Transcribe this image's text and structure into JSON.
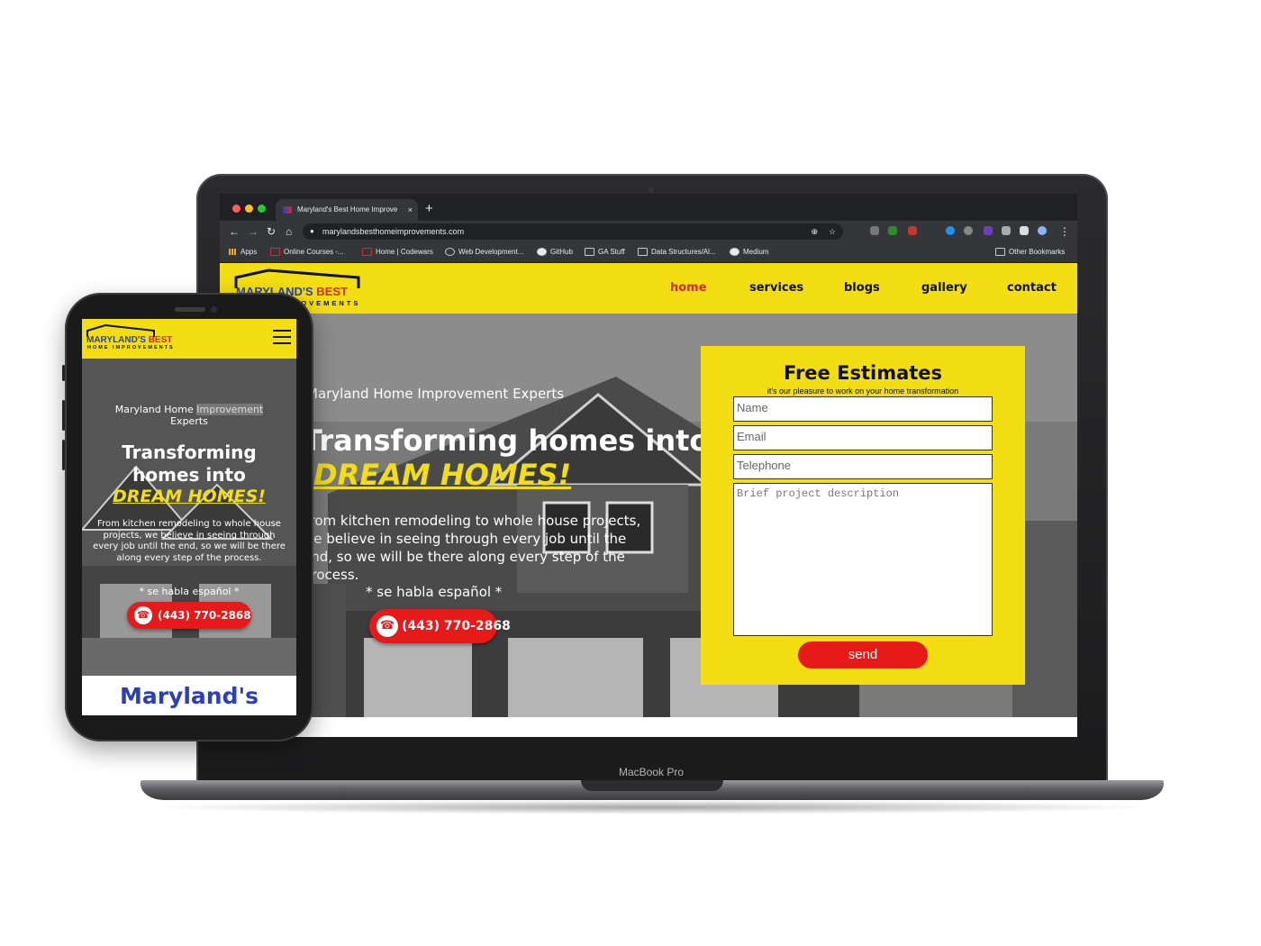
{
  "browser": {
    "tab_title": "Maryland's Best Home Improve",
    "tab_close": "×",
    "new_tab": "+",
    "url": "marylandsbesthomeimprovements.com",
    "bookmarks": [
      "Apps",
      "Online Courses -...",
      "Home | Codewars",
      "Web Development...",
      "GitHub",
      "GA Stuff",
      "Data Structures/Al...",
      "Medium"
    ],
    "other_bookmarks": "Other Bookmarks",
    "colors": {
      "frame": "#202124",
      "toolbar": "#35363a"
    }
  },
  "site": {
    "logo_main_a": "MARYLAND'S",
    "logo_main_b": "BEST",
    "logo_sub": "HOME IMPROVEMENTS",
    "nav": [
      "home",
      "services",
      "blogs",
      "gallery",
      "contact"
    ],
    "hero": {
      "kicker": "Maryland Home Improvement Experts",
      "title": "Transforming homes into",
      "dream": "DREAM HOMES!",
      "body": "From kitchen remodeling to whole house projects, we believe in seeing through every job until the end, so we will be there along every step of the process.",
      "spanish": "* se habla español *",
      "phone": "(443) 770-2868"
    },
    "estimate": {
      "title": "Free Estimates",
      "subtitle": "it's our pleasure to work on your home transformation",
      "name_placeholder": "Name",
      "email_placeholder": "Email",
      "telephone_placeholder": "Telephone",
      "description_placeholder": "Brief project description",
      "send": "send"
    },
    "colors": {
      "yellow": "#f3dd13",
      "red": "#e81919",
      "blue": "#2a3fb8"
    }
  },
  "device": {
    "laptop_label": "MacBook Pro"
  },
  "mobile": {
    "kicker_a": "Maryland Home",
    "kicker_b": "Improvement",
    "kicker_c": "Experts",
    "title_line1": "Transforming",
    "title_line2": "homes into",
    "brand_heading": "Maryland's"
  }
}
